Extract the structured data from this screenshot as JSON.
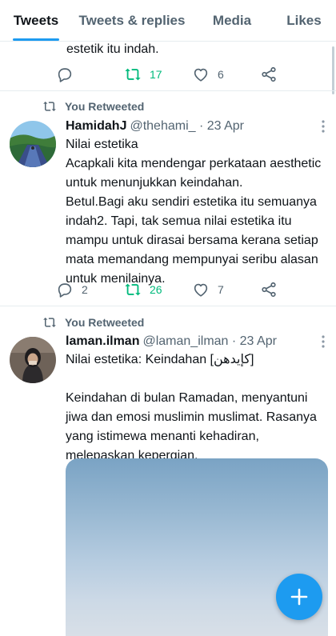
{
  "tabs": [
    {
      "label": "Tweets",
      "active": true
    },
    {
      "label": "Tweets & replies",
      "active": false
    },
    {
      "label": "Media",
      "active": false
    },
    {
      "label": "Likes",
      "active": false
    }
  ],
  "partial_tweet": {
    "text": "estetik itu indah.",
    "retweets": "17",
    "likes": "6"
  },
  "tweets": [
    {
      "retweet_label": "You Retweeted",
      "name": "HamidahJ",
      "handle": "@thehami_ · 23 Apr",
      "lines": [
        "Nilai estetika",
        "Acapkali kita mendengar perkataan aesthetic",
        "untuk menunjukkan keindahan.",
        "Betul.Bagi aku sendiri estetika itu semuanya",
        "indah2. Tapi, tak semua nilai estetika itu",
        "mampu untuk dirasai bersama kerana setiap",
        "mata memandang mempunyai seribu alasan",
        "untuk menilainya."
      ],
      "replies": "2",
      "retweets": "26",
      "likes": "7"
    },
    {
      "retweet_label": "You Retweeted",
      "name": "laman.ilman",
      "handle": "@laman_ilman · 23 Apr",
      "lines": [
        "Nilai estetika: Keindahan [کإيدهن]",
        "",
        "Keindahan di bulan Ramadan, menyantuni",
        "jiwa dan emosi muslimin muslimat. Rasanya",
        "yang istimewa menanti kehadiran,",
        "melepaskan kepergian."
      ]
    }
  ],
  "colors": {
    "accent": "#1d9bf0",
    "retweet_green": "#00ba7c",
    "secondary_text": "#536471"
  },
  "icons": [
    "reply-icon",
    "retweet-icon",
    "like-icon",
    "share-icon",
    "more-icon",
    "compose-plus-icon"
  ]
}
